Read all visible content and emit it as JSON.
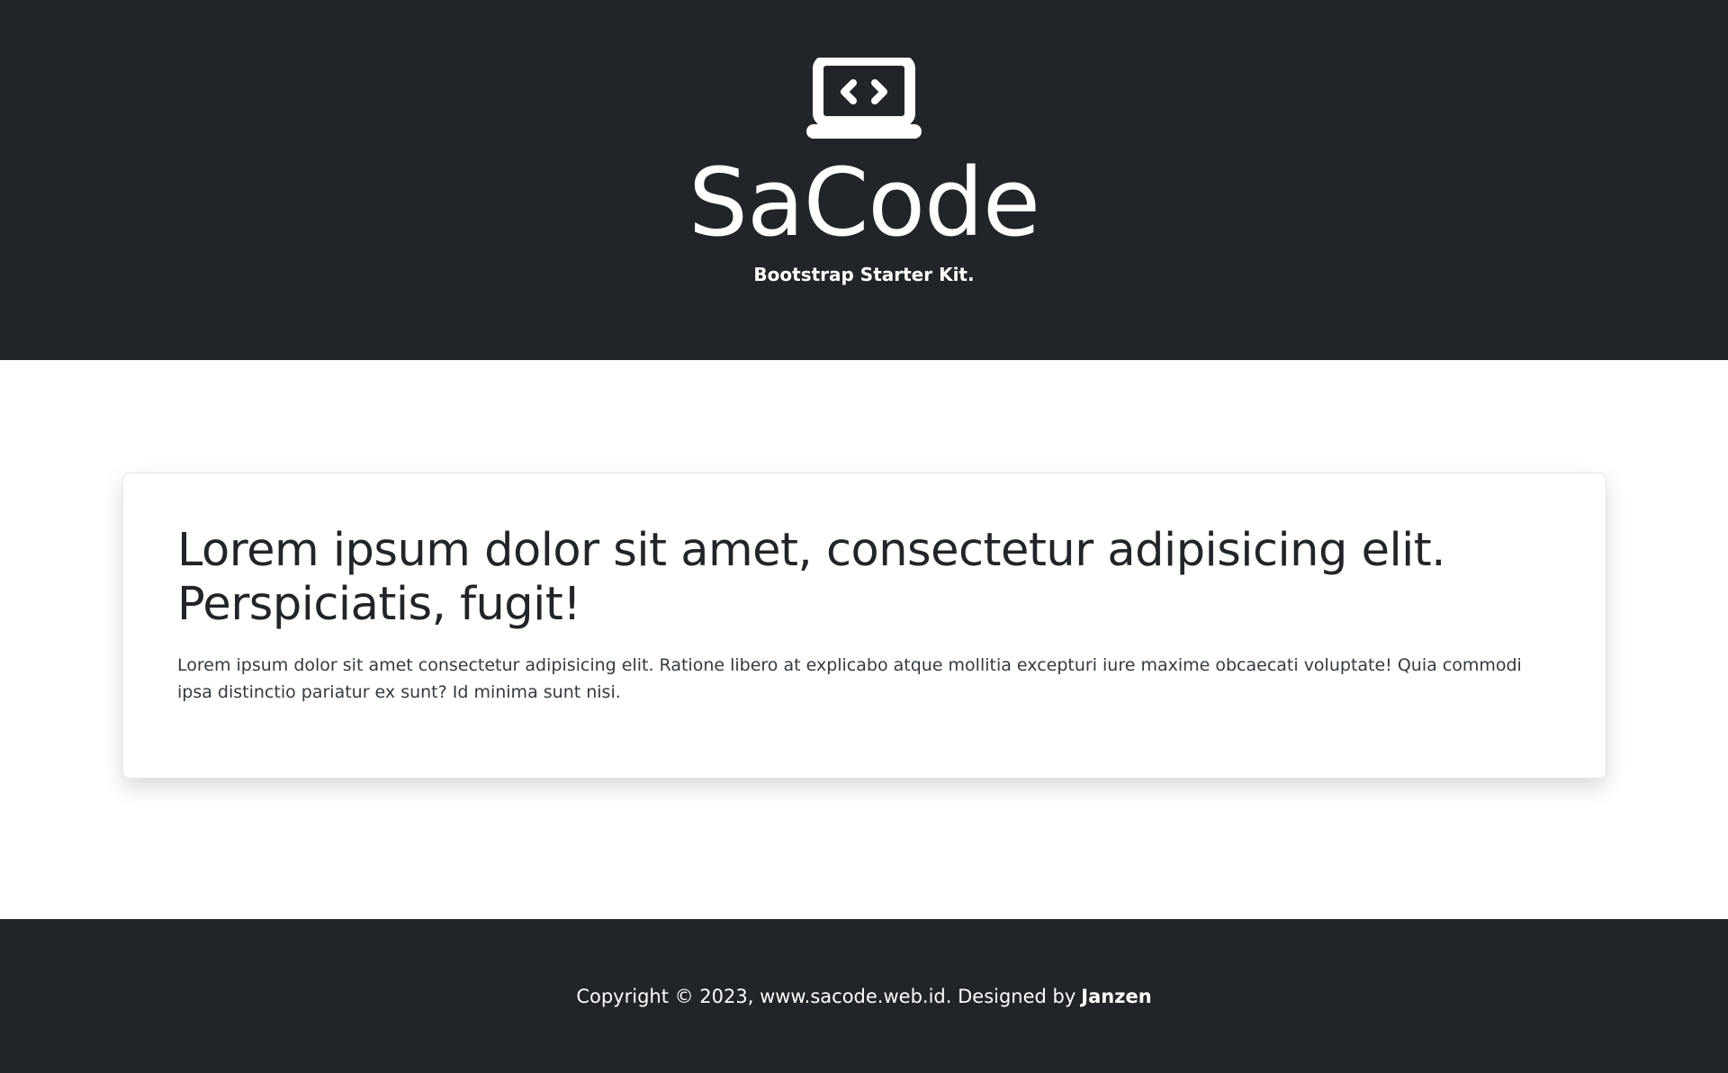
{
  "hero": {
    "logo_icon": "laptop-code-icon",
    "brand": "SaCode",
    "tagline": "Bootstrap Starter Kit."
  },
  "card": {
    "title": "Lorem ipsum dolor sit amet, consectetur adipisicing elit. Perspiciatis, fugit!",
    "text": "Lorem ipsum dolor sit amet consectetur adipisicing elit. Ratione libero at explicabo atque mollitia excepturi iure maxime obcaecati voluptate! Quia commodi ipsa distinctio pariatur ex sunt? Id minima sunt nisi."
  },
  "footer": {
    "copyright": "Copyright © 2023, www.sacode.web.id. Designed by",
    "designer": "Janzen"
  },
  "colors": {
    "dark_bg": "#212529",
    "text_light": "#ffffff",
    "text_dark": "#212529"
  }
}
